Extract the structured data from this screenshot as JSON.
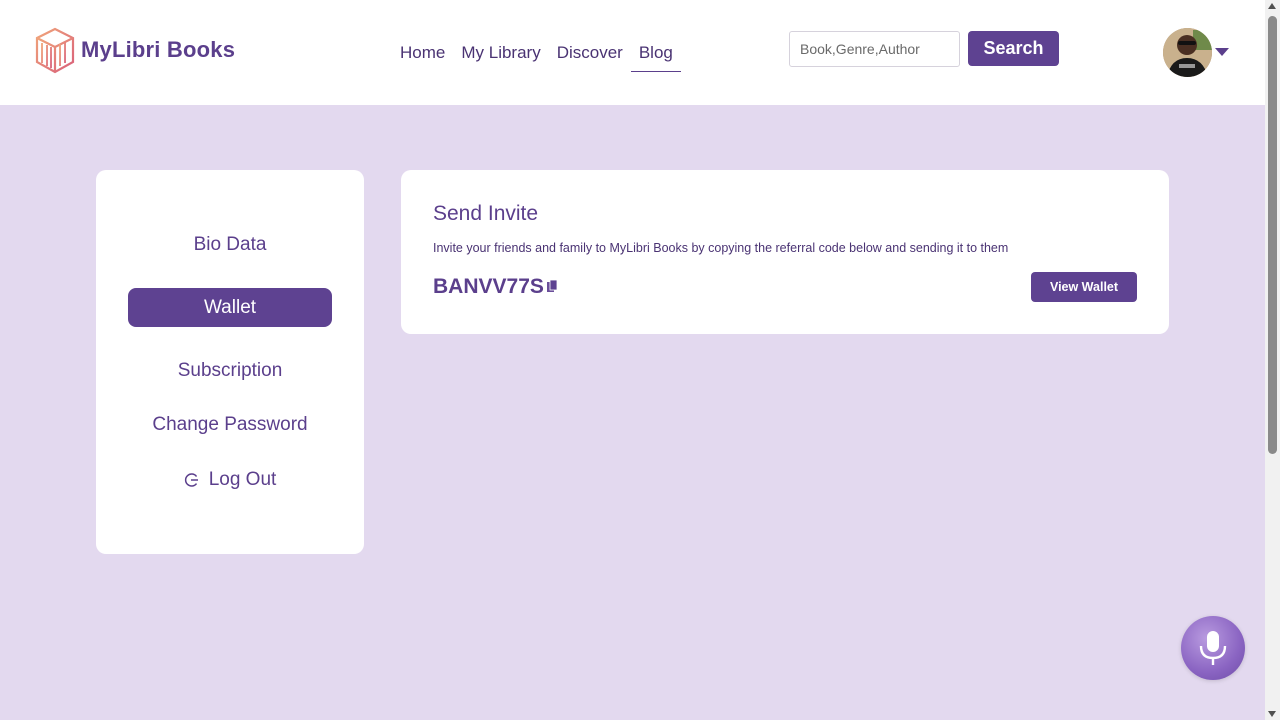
{
  "brand": {
    "name": "MyLibri Books",
    "accent_color": "#5e4291",
    "background_color": "#e3d9ef"
  },
  "nav": {
    "items": [
      {
        "label": "Home"
      },
      {
        "label": "My Library"
      },
      {
        "label": "Discover"
      },
      {
        "label": "Blog",
        "active": true
      }
    ]
  },
  "search": {
    "placeholder": "Book,Genre,Author",
    "value": "",
    "button_label": "Search"
  },
  "user_menu": {
    "avatar_icon": "user-avatar",
    "caret_icon": "caret-down-icon"
  },
  "sidebar": {
    "items": [
      {
        "label": "Bio Data"
      },
      {
        "label": "Wallet",
        "active": true
      },
      {
        "label": "Subscription"
      },
      {
        "label": "Change Password"
      },
      {
        "label": "Log Out",
        "icon": "logout-icon"
      }
    ]
  },
  "invite": {
    "title": "Send Invite",
    "description": "Invite your friends and family to MyLibri Books by copying the referral code below and sending it to them",
    "referral_code": "BANVV77S",
    "copy_icon": "copy-icon",
    "wallet_button_label": "View Wallet"
  },
  "assistant": {
    "icon": "microphone-icon"
  }
}
